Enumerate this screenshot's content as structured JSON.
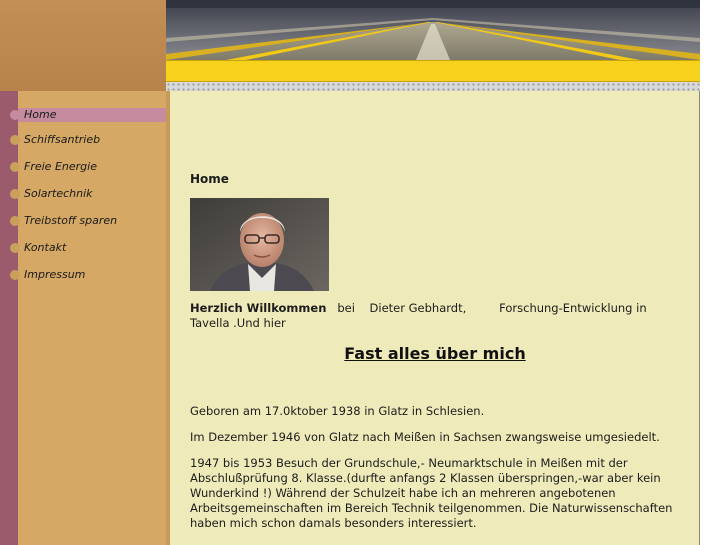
{
  "colors": {
    "header_left": "#c48f55",
    "header_yellow": "#f7d11c",
    "left_stripe": "#9c5b6c",
    "nav_background": "#d6a865",
    "nav_active": "#c58b9e",
    "content_background": "#eeeaba"
  },
  "header": {
    "image_icon": "runway-perspective-image"
  },
  "nav": {
    "items": [
      {
        "label": "Home",
        "active": true
      },
      {
        "label": "Schiffsantrieb",
        "active": false
      },
      {
        "label": "Freie Energie",
        "active": false
      },
      {
        "label": "Solartechnik",
        "active": false
      },
      {
        "label": "Treibstoff sparen",
        "active": false
      },
      {
        "label": "Kontakt",
        "active": false
      },
      {
        "label": "Impressum",
        "active": false
      }
    ]
  },
  "content": {
    "heading": "Home",
    "photo_icon": "portrait-photo",
    "welcome_bold": "Herzlich Willkommen",
    "welcome_rest": "   bei    Dieter Gebhardt,         Forschung-Entwicklung in Tavella .Und hier",
    "section_title": "Fast alles über mich",
    "paragraphs": [
      "Geboren am 17.0ktober 1938 in Glatz in Schlesien.",
      "Im Dezember 1946 von Glatz nach Meißen in Sachsen zwangsweise umgesiedelt.",
      "1947 bis 1953 Besuch der Grundschule,- Neumarktschule in  Meißen mit der Abschlußprüfung 8. Klasse.(durfte anfangs 2 Klassen überspringen,-war aber kein Wunderkind !)  Während der Schulzeit habe ich an mehreren angebotenen Arbeitsgemeinschaften im Bereich Technik teilgenommen. Die Naturwissenschaften haben mich schon damals besonders interessiert."
    ]
  }
}
